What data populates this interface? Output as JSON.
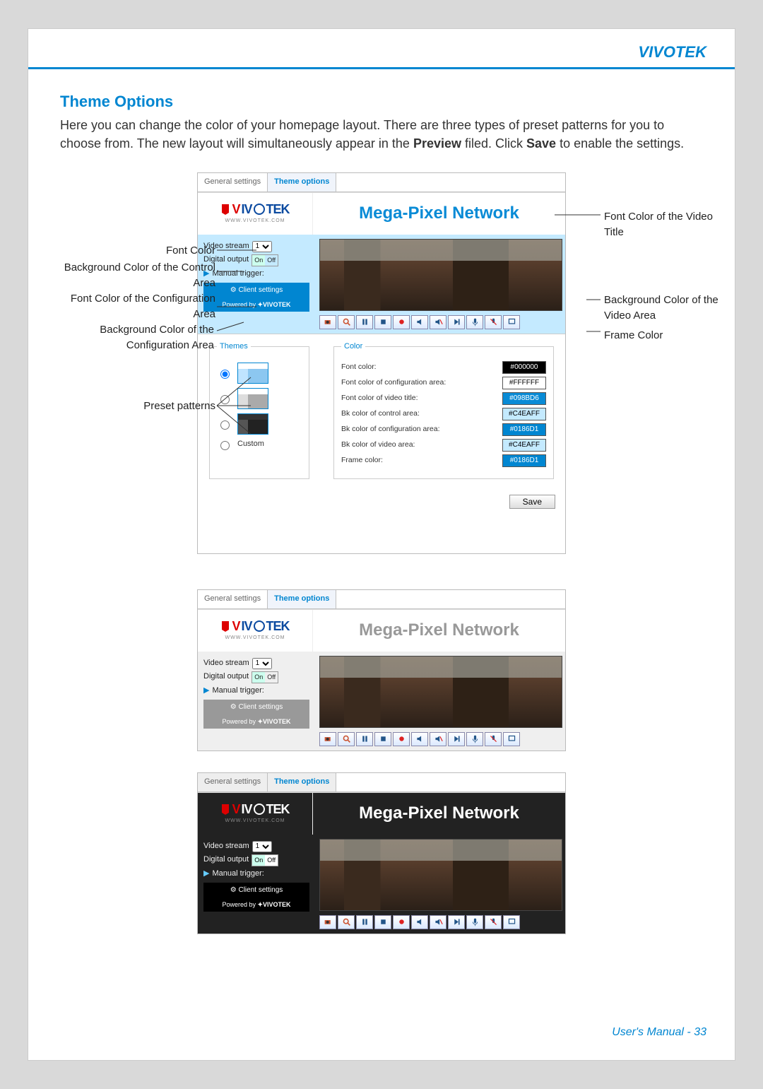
{
  "brand": "VIVOTEK",
  "section_title": "Theme Options",
  "intro_1": "Here you can change the color of your homepage layout. There are three types of preset patterns for you to choose from. The new layout will simultaneously appear in the ",
  "intro_bold1": "Preview",
  "intro_2": " filed. Click ",
  "intro_bold2": "Save",
  "intro_3": " to enable the settings.",
  "footer": "User's Manual - 33",
  "tabs": {
    "general": "General settings",
    "theme": "Theme options"
  },
  "logo": {
    "text": "VIVOTEK",
    "sub": "WWW.VIVOTEK.COM"
  },
  "video_title": "Mega-Pixel Network",
  "controls": {
    "stream_label": "Video stream",
    "stream_value": "1",
    "digital_label": "Digital output",
    "on": "On",
    "off": "Off",
    "trigger_label": "Manual trigger:",
    "client": "Client settings",
    "powered": "Powered by"
  },
  "themes_legend": "Themes",
  "custom_label": "Custom",
  "color_legend": "Color",
  "colors": [
    {
      "label": "Font color:",
      "value": "#000000",
      "bg": "#000000",
      "fg": "#fff"
    },
    {
      "label": "Font color of configuration area:",
      "value": "#FFFFFF",
      "bg": "#FFFFFF",
      "fg": "#000"
    },
    {
      "label": "Font color of video title:",
      "value": "#098BD6",
      "bg": "#098BD6",
      "fg": "#fff"
    },
    {
      "label": "Bk color of control area:",
      "value": "#C4EAFF",
      "bg": "#C4EAFF",
      "fg": "#000"
    },
    {
      "label": "Bk color of configuration area:",
      "value": "#0186D1",
      "bg": "#0186D1",
      "fg": "#fff"
    },
    {
      "label": "Bk color of video area:",
      "value": "#C4EAFF",
      "bg": "#C4EAFF",
      "fg": "#000"
    },
    {
      "label": "Frame color:",
      "value": "#0186D1",
      "bg": "#0186D1",
      "fg": "#fff"
    }
  ],
  "save": "Save",
  "callouts": {
    "font_color": "Font Color",
    "bg_control": "Background Color of the\nControl Area",
    "font_cfg": "Font Color of\nthe Configuration Area",
    "bg_cfg": "Background Color of the\nConfiguration Area",
    "preset": "Preset patterns",
    "title_color": "Font Color of the\nVideo Title",
    "bg_video": "Background Color of\nthe Video Area",
    "frame": "Frame Color"
  }
}
